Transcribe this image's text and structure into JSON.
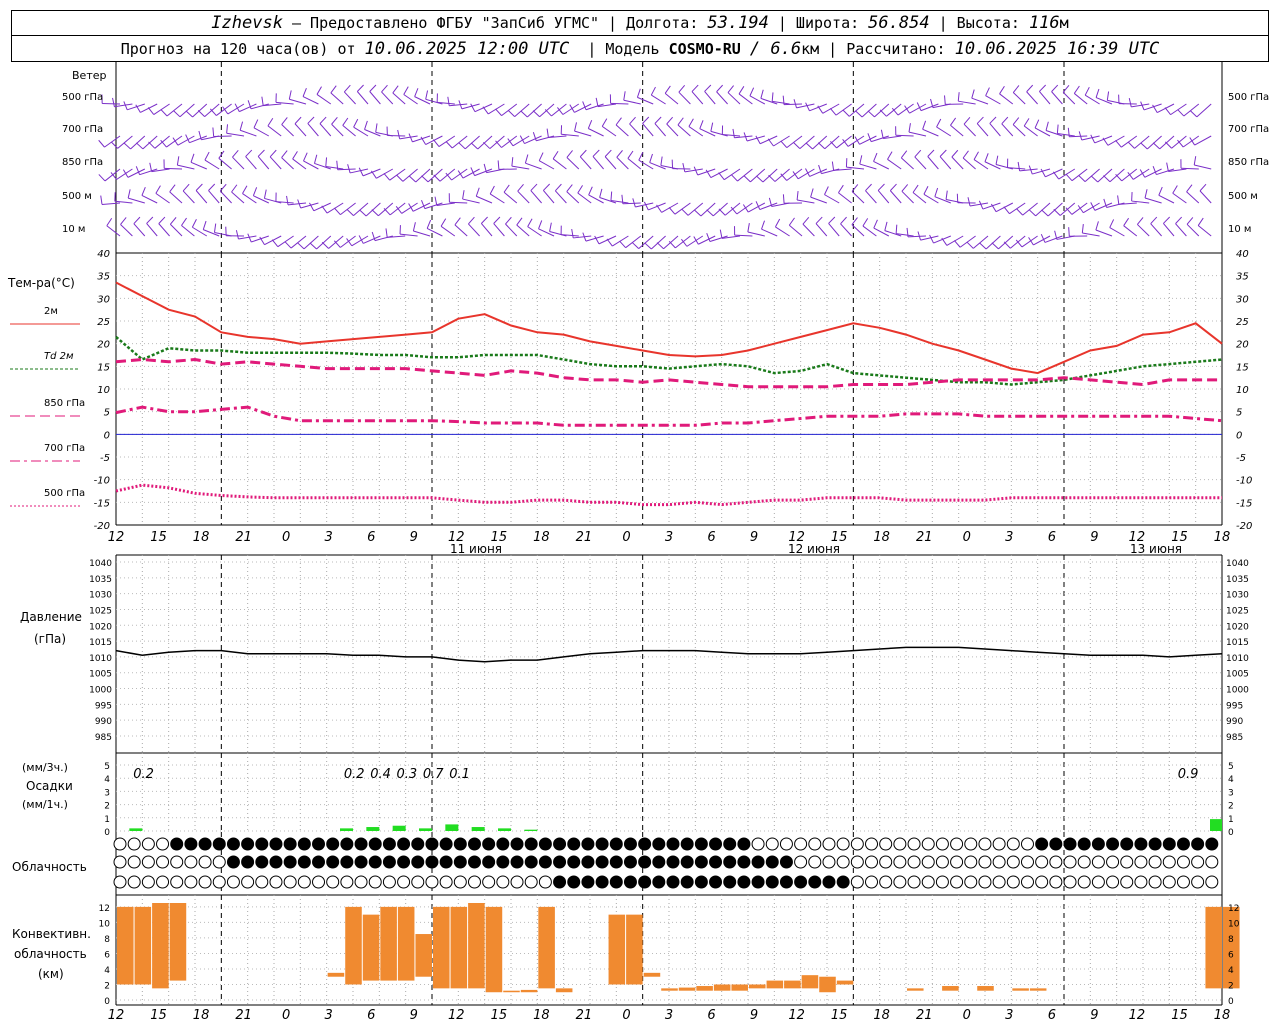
{
  "header": {
    "station": "Izhevsk",
    "line1_mid": "— Предоставлено ФГБУ \"ЗапСиб УГМС\" | Долгота:",
    "lon": "53.194",
    "lat_label": "| Широта:",
    "lat": "56.854",
    "alt_label": "| Высота:",
    "alt": "116",
    "alt_unit": "м",
    "line2_a": "Прогноз на 120 часа(ов) от",
    "run": "10.06.2025 12:00 UTC",
    "model_label": "| Модель",
    "model": "COSMO-RU",
    "res": "/ 6.6",
    "res_unit": "км",
    "calc_label": "| Рассчитано:",
    "calc": "10.06.2025 16:39 UTC"
  },
  "panels": {
    "wind": {
      "title": "Ветер",
      "levels": [
        "500 гПа",
        "700 гПа",
        "850 гПа",
        "500 м",
        "10  м"
      ]
    },
    "temp": {
      "title": "Тем-ра(°C)",
      "legend": [
        "2м",
        "Td  2м",
        "850 гПа",
        "700 гПа",
        "500 гПа"
      ]
    },
    "pressure": {
      "title": "Давление",
      "unit": "(гПа)"
    },
    "precip": {
      "unit_top": "(мм/3ч.)",
      "title": "Осадки",
      "unit_bottom": "(мм/1ч.)"
    },
    "cloud": {
      "title": "Облачность"
    },
    "conv": {
      "title1": "Конвективн.",
      "title2": "облачность",
      "unit": "(км)"
    }
  },
  "time_axis": {
    "ticks": [
      "12",
      "15",
      "18",
      "21",
      "0",
      "3",
      "6",
      "9",
      "12",
      "15",
      "18",
      "21",
      "0",
      "3",
      "6",
      "9",
      "12",
      "15",
      "18",
      "21",
      "0",
      "3",
      "6",
      "9",
      "12",
      "15",
      "18"
    ],
    "days": [
      "11 июня",
      "12 июня",
      "13 июня"
    ]
  },
  "colors": {
    "t2m": "#e8352c",
    "td": "#1a7a1a",
    "t850": "#e01a7a",
    "t700": "#e01a7a",
    "t500": "#e01a7a",
    "zero": "#2020d0",
    "pressure": "#000000",
    "precip": "#22dd22",
    "conv": "#f08a30",
    "wind": "#7a2ec8"
  },
  "chart_data": [
    {
      "type": "line",
      "title": "Тем-ра(°C)",
      "ylim": [
        -20,
        40
      ],
      "yticks": [
        -20,
        -15,
        -10,
        -5,
        0,
        5,
        10,
        15,
        20,
        25,
        30,
        35,
        40
      ],
      "x_hours": [
        0,
        3,
        6,
        9,
        12,
        15,
        18,
        21,
        24,
        27,
        30,
        33,
        36,
        39,
        42,
        45,
        48,
        51,
        54,
        57,
        60,
        63,
        66,
        69,
        72,
        75,
        78,
        81,
        84,
        87,
        90,
        93,
        96,
        99,
        102,
        105,
        108,
        111,
        114,
        117,
        120,
        123,
        126
      ],
      "series": [
        {
          "name": "2м",
          "values": [
            33.5,
            30.5,
            27.5,
            26,
            22.5,
            21.5,
            21,
            20,
            20.5,
            21,
            21.5,
            22,
            22.5,
            25.5,
            26.5,
            24,
            22.5,
            22,
            20.5,
            19.5,
            18.5,
            17.5,
            17.2,
            17.5,
            18.5,
            20,
            21.5,
            23,
            24.5,
            23.5,
            22,
            20,
            18.5,
            16.5,
            14.5,
            13.5,
            16,
            18.5,
            19.5,
            22,
            22.5,
            24.5,
            20
          ]
        },
        {
          "name": "Td  2м",
          "values": [
            21.5,
            16.5,
            19,
            18.5,
            18.5,
            18,
            18,
            18,
            18,
            17.8,
            17.5,
            17.5,
            17,
            17,
            17.5,
            17.5,
            17.5,
            16.5,
            15.5,
            15,
            15,
            14.5,
            15,
            15.5,
            15,
            13.5,
            14,
            15.5,
            13.5,
            13,
            12.5,
            12,
            11.5,
            11.5,
            11,
            11.5,
            12,
            13,
            14,
            15,
            15.5,
            16,
            16.5
          ]
        },
        {
          "name": "850 гПа",
          "values": [
            16,
            16.5,
            16,
            16.5,
            15.5,
            16,
            15.5,
            15,
            14.5,
            14.5,
            14.5,
            14.5,
            14,
            13.5,
            13,
            14,
            13.5,
            12.5,
            12,
            12,
            11.5,
            12,
            11.5,
            11,
            10.5,
            10.5,
            10.5,
            10.5,
            11,
            11,
            11,
            11.5,
            12,
            12,
            12,
            12,
            12.5,
            12,
            11.5,
            11,
            12,
            12,
            12
          ]
        },
        {
          "name": "700 гПа",
          "values": [
            4.8,
            6,
            5,
            5,
            5.5,
            6,
            4,
            3,
            3,
            3,
            3,
            3,
            3,
            2.8,
            2.5,
            2.5,
            2.5,
            2,
            2,
            2,
            2,
            2,
            2,
            2.5,
            2.5,
            3,
            3.5,
            4,
            4,
            4,
            4.5,
            4.5,
            4.5,
            4,
            4,
            4,
            4,
            4,
            4,
            4,
            4,
            3.5,
            3
          ]
        },
        {
          "name": "500 гПа",
          "values": [
            -12.5,
            -11.2,
            -11.8,
            -13,
            -13.5,
            -13.8,
            -14,
            -14,
            -14,
            -14,
            -14,
            -14,
            -14,
            -14.5,
            -15,
            -15,
            -14.5,
            -14.5,
            -15,
            -15,
            -15.5,
            -15.5,
            -15,
            -15.5,
            -15,
            -14.5,
            -14.5,
            -14,
            -14,
            -14,
            -14.5,
            -14.5,
            -14.5,
            -14.5,
            -14,
            -14,
            -14,
            -14,
            -14,
            -14,
            -14,
            -14,
            -14
          ]
        }
      ]
    },
    {
      "type": "line",
      "title": "Давление",
      "ylabel": "(гПа)",
      "ylim": [
        985,
        1040
      ],
      "yticks": [
        985,
        990,
        995,
        1000,
        1005,
        1010,
        1015,
        1020,
        1025,
        1030,
        1035,
        1040
      ],
      "x_hours": [
        0,
        3,
        6,
        9,
        12,
        15,
        18,
        21,
        24,
        27,
        30,
        33,
        36,
        39,
        42,
        45,
        48,
        51,
        54,
        57,
        60,
        63,
        66,
        69,
        72,
        75,
        78,
        81,
        84,
        87,
        90,
        93,
        96,
        99,
        102,
        105,
        108,
        111,
        114,
        117,
        120,
        123,
        126
      ],
      "series": [
        {
          "name": "Давление",
          "values": [
            1012,
            1010.5,
            1011.5,
            1012,
            1012,
            1011,
            1011,
            1011,
            1011,
            1010.5,
            1010.5,
            1010,
            1010,
            1009,
            1008.5,
            1009,
            1009,
            1010,
            1011,
            1011.5,
            1012,
            1012,
            1012,
            1011.5,
            1011,
            1011,
            1011,
            1011.5,
            1012,
            1012.5,
            1013,
            1013,
            1013,
            1012.5,
            1012,
            1011.5,
            1011,
            1010.5,
            1010.5,
            1010.5,
            1010,
            1010.5,
            1011
          ]
        }
      ]
    },
    {
      "type": "bar",
      "title": "Осадки",
      "ylim": [
        0,
        5
      ],
      "x_hours": [
        3,
        27,
        30,
        33,
        36,
        39,
        42,
        45,
        48,
        126
      ],
      "values_1h": [
        0.2,
        0.2,
        0.3,
        0.4,
        0.2,
        0.5,
        0.3,
        0.2,
        0.1,
        0.9
      ],
      "labels_3h": [
        {
          "h": 2,
          "text": "0.2"
        },
        {
          "h": 26,
          "text": "0.2"
        },
        {
          "h": 29,
          "text": "0.4"
        },
        {
          "h": 32,
          "text": "0.3"
        },
        {
          "h": 35,
          "text": "0.7"
        },
        {
          "h": 38,
          "text": "0.1"
        },
        {
          "h": 121,
          "text": "0.9"
        }
      ]
    },
    {
      "type": "bar",
      "title": "Конвективн. облачность",
      "ylabel": "(км)",
      "ylim": [
        0,
        13
      ],
      "yticks": [
        0,
        2,
        4,
        6,
        8,
        10,
        12
      ],
      "bars": [
        {
          "h": 0,
          "lo": 2,
          "hi": 12
        },
        {
          "h": 2,
          "lo": 2,
          "hi": 12
        },
        {
          "h": 4,
          "lo": 1.5,
          "hi": 12.5
        },
        {
          "h": 6,
          "lo": 2.5,
          "hi": 12.5
        },
        {
          "h": 24,
          "lo": 3,
          "hi": 3.5
        },
        {
          "h": 26,
          "lo": 2,
          "hi": 12
        },
        {
          "h": 28,
          "lo": 2.5,
          "hi": 11
        },
        {
          "h": 30,
          "lo": 2.5,
          "hi": 12
        },
        {
          "h": 32,
          "lo": 2.5,
          "hi": 12
        },
        {
          "h": 34,
          "lo": 3,
          "hi": 8.5
        },
        {
          "h": 36,
          "lo": 1.5,
          "hi": 12
        },
        {
          "h": 38,
          "lo": 1.5,
          "hi": 12
        },
        {
          "h": 40,
          "lo": 1.5,
          "hi": 12.5
        },
        {
          "h": 42,
          "lo": 1,
          "hi": 12
        },
        {
          "h": 44,
          "lo": 1,
          "hi": 1.2
        },
        {
          "h": 46,
          "lo": 1,
          "hi": 1.3
        },
        {
          "h": 48,
          "lo": 1.5,
          "hi": 12
        },
        {
          "h": 50,
          "lo": 1,
          "hi": 1.5
        },
        {
          "h": 56,
          "lo": 2,
          "hi": 11
        },
        {
          "h": 58,
          "lo": 2,
          "hi": 11
        },
        {
          "h": 60,
          "lo": 3,
          "hi": 3.5
        },
        {
          "h": 62,
          "lo": 1.2,
          "hi": 1.5
        },
        {
          "h": 64,
          "lo": 1.2,
          "hi": 1.6
        },
        {
          "h": 66,
          "lo": 1.2,
          "hi": 1.8
        },
        {
          "h": 68,
          "lo": 1.2,
          "hi": 2
        },
        {
          "h": 70,
          "lo": 1.2,
          "hi": 2
        },
        {
          "h": 72,
          "lo": 1.5,
          "hi": 2
        },
        {
          "h": 74,
          "lo": 1.5,
          "hi": 2.5
        },
        {
          "h": 76,
          "lo": 1.5,
          "hi": 2.5
        },
        {
          "h": 78,
          "lo": 1.5,
          "hi": 3.2
        },
        {
          "h": 80,
          "lo": 1,
          "hi": 3
        },
        {
          "h": 82,
          "lo": 2,
          "hi": 2.5
        },
        {
          "h": 90,
          "lo": 1.2,
          "hi": 1.5
        },
        {
          "h": 94,
          "lo": 1.2,
          "hi": 1.8
        },
        {
          "h": 98,
          "lo": 1.2,
          "hi": 1.8
        },
        {
          "h": 102,
          "lo": 1.2,
          "hi": 1.5
        },
        {
          "h": 104,
          "lo": 1.2,
          "hi": 1.5
        },
        {
          "h": 124,
          "lo": 1.5,
          "hi": 12
        },
        {
          "h": 126,
          "lo": 1.5,
          "hi": 12
        }
      ]
    }
  ]
}
